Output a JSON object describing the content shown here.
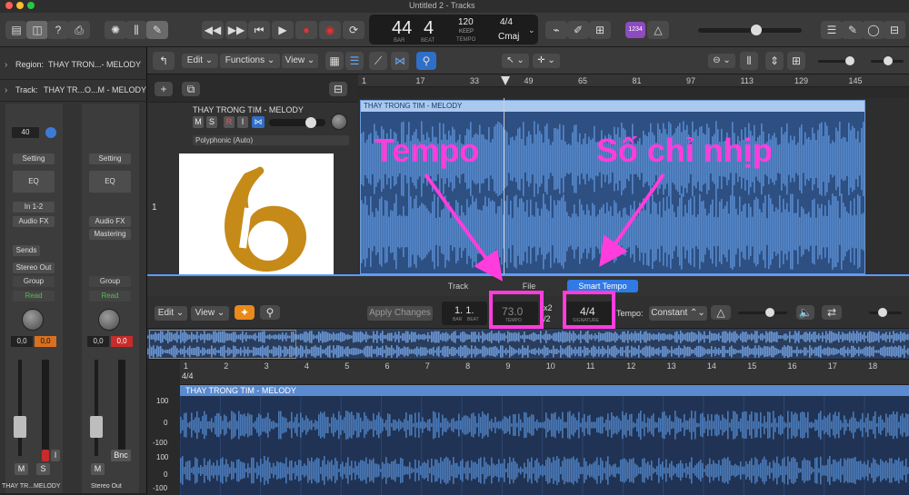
{
  "window": {
    "title": "Untitled 2 - Tracks"
  },
  "lcd": {
    "bar": "44",
    "beat": "4",
    "bar_label": "BAR",
    "beat_label": "BEAT",
    "tempo": "120",
    "keep": "KEEP",
    "tempo_label": "TEMPO",
    "signature": "4/4",
    "key": "Cmaj"
  },
  "badge": "1234",
  "inspector": {
    "region": {
      "label": "Region:",
      "name": "THAY TRON...- MELODY"
    },
    "track": {
      "label": "Track:",
      "name": "THAY TR...O...M - MELODY"
    },
    "strip1": {
      "value": "40",
      "setting": "Setting",
      "eq": "EQ",
      "input": "In 1-2",
      "audiofx": "Audio FX",
      "sends": "Sends",
      "output": "Stereo Out",
      "group": "Group",
      "read": "Read",
      "vol": "0,0",
      "peak": "0,0",
      "name": "THAY TR...MELODY",
      "m": "M",
      "s": "S",
      "i": "I"
    },
    "strip2": {
      "setting": "Setting",
      "eq": "EQ",
      "audiofx": "Audio FX",
      "mastering": "Mastering",
      "group": "Group",
      "read": "Read",
      "vol": "0,0",
      "peak": "0,0",
      "name": "Stereo Out",
      "m": "M",
      "bnc": "Bnc"
    }
  },
  "tracks_toolbar": {
    "edit": "Edit",
    "functions": "Functions",
    "view": "View"
  },
  "track_header": {
    "name": "THAY TRONG TIM - MELODY",
    "mute": "M",
    "solo": "S",
    "record": "R",
    "input_monitor": "I",
    "mode": "Polyphonic (Auto)",
    "number": "1"
  },
  "ruler": [
    "1",
    "17",
    "33",
    "49",
    "65",
    "81",
    "97",
    "113",
    "129",
    "145"
  ],
  "region": {
    "name": "THAY TRONG TIM - MELODY"
  },
  "editor": {
    "tabs": [
      "Track",
      "File",
      "Smart Tempo"
    ],
    "edit": "Edit",
    "view": "View",
    "apply_changes": "Apply Changes",
    "position": "1. 1.",
    "bar_label": "BAR",
    "beat_label": "BEAT",
    "tempo": "73.0",
    "tempo_label": "TEMPO",
    "x2": "x2",
    "half": "/2",
    "signature": "4/4",
    "signature_label": "SIGNATURE",
    "tempo_mode_label": "Tempo:",
    "tempo_mode": "Constant",
    "ruler": [
      "1",
      "2",
      "3",
      "4",
      "5",
      "6",
      "7",
      "8",
      "9",
      "10",
      "11",
      "12",
      "13",
      "14",
      "15",
      "16",
      "17",
      "18"
    ],
    "ruler_sig": "4/4",
    "region_name": "THAY TRONG TIM - MELODY",
    "amp_labels": [
      "100",
      "0",
      "-100",
      "100",
      "0",
      "-100"
    ]
  },
  "annotations": {
    "tempo": "Tempo",
    "signature": "Số chỉ nhịp"
  },
  "colors": {
    "accent": "#2f7ae5",
    "annotation": "#ff3cdc",
    "waveform": "#4a7ab8",
    "region_header": "#a9c9ef",
    "smart_tempo_tab": "#2f7ae5",
    "tool_orange": "#e98a1b",
    "peak_red": "#c92a2a",
    "peak_orange": "#d87020"
  }
}
